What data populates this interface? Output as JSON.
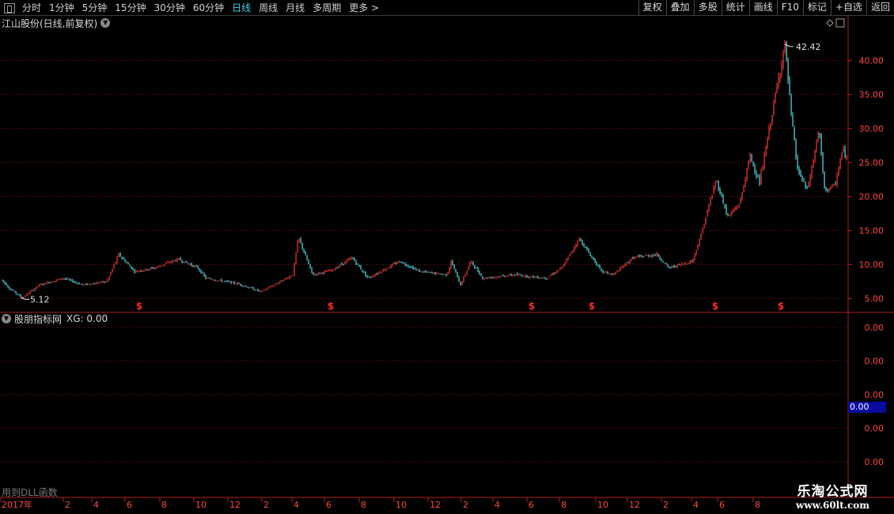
{
  "toolbar": {
    "periods": [
      "分时",
      "1分钟",
      "5分钟",
      "15分钟",
      "30分钟",
      "60分钟",
      "日线",
      "周线",
      "月线",
      "多周期",
      "更多 >"
    ],
    "active_period": "日线",
    "right_buttons": [
      "复权",
      "叠加",
      "多股",
      "统计",
      "画线",
      "F10",
      "标记",
      "+自选",
      "返回"
    ]
  },
  "main": {
    "title": "江山股份(日线,前复权)",
    "max_label": "42.42",
    "min_label": "5.12",
    "marker_glyph": "$"
  },
  "indicator": {
    "title": "股朋指标网",
    "xg_label": "XG: 0.00",
    "current_value": "0.00",
    "axis_labels": [
      "0.00",
      "0.00",
      "0.00",
      "0.00",
      "0.00"
    ]
  },
  "dll_note": "用到DLL函数",
  "time_axis": {
    "labels": [
      "2017年",
      "2",
      "4",
      "6",
      "8",
      "10",
      "12",
      "2",
      "4",
      "6",
      "8",
      "10",
      "12",
      "2",
      "4",
      "6",
      "8",
      "10",
      "12",
      "2",
      "4",
      "6",
      "8"
    ]
  },
  "watermark": {
    "title": "乐淘公式网",
    "url": "www.60lt.com"
  },
  "colors": {
    "up": "#ff3a3a",
    "down": "#54e6f0",
    "grid": "#7a1414",
    "frame": "#b01e1e",
    "axis_text": "#ff4646"
  },
  "chart_data": {
    "type": "candlestick",
    "y_ticks": [
      5,
      10,
      15,
      20,
      25,
      30,
      35,
      40
    ],
    "ylim": [
      3.2,
      44.5
    ],
    "price_path": [
      [
        0,
        8.0
      ],
      [
        12,
        6.5
      ],
      [
        28,
        5.12
      ],
      [
        50,
        7.0
      ],
      [
        80,
        8.0
      ],
      [
        105,
        7.0
      ],
      [
        135,
        7.5
      ],
      [
        150,
        11.5
      ],
      [
        170,
        9.0
      ],
      [
        195,
        9.5
      ],
      [
        225,
        10.8
      ],
      [
        250,
        9.5
      ],
      [
        260,
        8.0
      ],
      [
        300,
        7.2
      ],
      [
        330,
        6.0
      ],
      [
        370,
        8.5
      ],
      [
        377,
        14.0
      ],
      [
        395,
        8.5
      ],
      [
        420,
        9.2
      ],
      [
        445,
        11.0
      ],
      [
        465,
        8.0
      ],
      [
        505,
        10.5
      ],
      [
        530,
        9.0
      ],
      [
        565,
        8.5
      ],
      [
        570,
        10.5
      ],
      [
        582,
        7.0
      ],
      [
        595,
        10.5
      ],
      [
        610,
        8.0
      ],
      [
        650,
        8.5
      ],
      [
        690,
        8.0
      ],
      [
        710,
        9.5
      ],
      [
        732,
        13.8
      ],
      [
        760,
        9.0
      ],
      [
        775,
        8.5
      ],
      [
        800,
        11.0
      ],
      [
        830,
        11.5
      ],
      [
        845,
        9.5
      ],
      [
        875,
        10.5
      ],
      [
        885,
        14.0
      ],
      [
        905,
        22.5
      ],
      [
        920,
        17.0
      ],
      [
        935,
        19.0
      ],
      [
        948,
        26.0
      ],
      [
        960,
        22.0
      ],
      [
        977,
        33.0
      ],
      [
        992,
        42.42
      ],
      [
        1000,
        32.0
      ],
      [
        1008,
        24.0
      ],
      [
        1020,
        21.0
      ],
      [
        1025,
        23.5
      ],
      [
        1035,
        30.0
      ],
      [
        1042,
        21.0
      ],
      [
        1055,
        21.5
      ],
      [
        1065,
        27.0
      ],
      [
        1072,
        25.0
      ]
    ],
    "markers_x": [
      176,
      418,
      672,
      748,
      904,
      987
    ],
    "max_point": {
      "x": 992,
      "value": 42.42
    },
    "min_point": {
      "x": 28,
      "value": 5.12
    }
  }
}
